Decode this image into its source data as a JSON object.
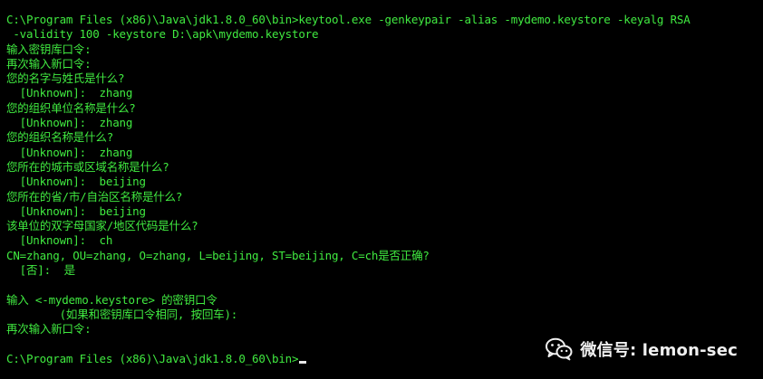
{
  "terminal": {
    "lines": [
      "C:\\Program Files (x86)\\Java\\jdk1.8.0_60\\bin>keytool.exe -genkeypair -alias -mydemo.keystore -keyalg RSA",
      " -validity 100 -keystore D:\\apk\\mydemo.keystore",
      "输入密钥库口令:",
      "再次输入新口令:",
      "您的名字与姓氏是什么?",
      "  [Unknown]:  zhang",
      "您的组织单位名称是什么?",
      "  [Unknown]:  zhang",
      "您的组织名称是什么?",
      "  [Unknown]:  zhang",
      "您所在的城市或区域名称是什么?",
      "  [Unknown]:  beijing",
      "您所在的省/市/自治区名称是什么?",
      "  [Unknown]:  beijing",
      "该单位的双字母国家/地区代码是什么?",
      "  [Unknown]:  ch",
      "CN=zhang, OU=zhang, O=zhang, L=beijing, ST=beijing, C=ch是否正确?",
      "  [否]:  是",
      "",
      "输入 <-mydemo.keystore> 的密钥口令",
      "        (如果和密钥库口令相同, 按回车):",
      "再次输入新口令:",
      "",
      "C:\\Program Files (x86)\\Java\\jdk1.8.0_60\\bin>"
    ]
  },
  "watermark": {
    "icon": "wechat-icon",
    "text": "微信号: lemon-sec"
  },
  "colors": {
    "background": "#000000",
    "terminal_text": "#40ea40",
    "cursor": "#e8e8e8",
    "watermark_text": "#f0f0f0"
  }
}
